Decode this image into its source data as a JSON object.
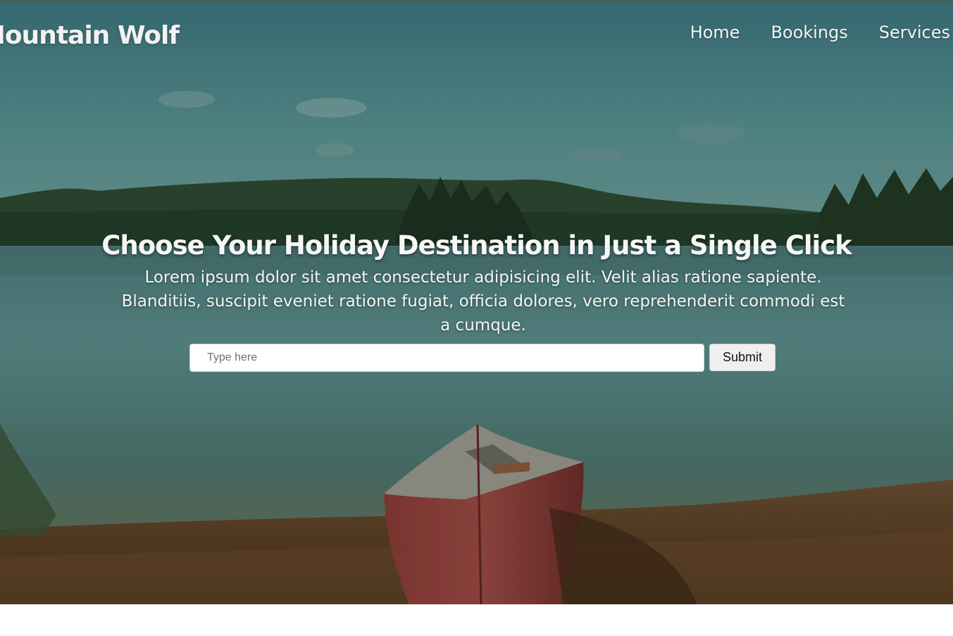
{
  "brand": {
    "name": "Mountain Wolf"
  },
  "nav": {
    "items": [
      {
        "label": "Home"
      },
      {
        "label": "Bookings"
      },
      {
        "label": "Services"
      }
    ]
  },
  "hero": {
    "headline": "Choose Your Holiday Destination in Just a Single Click",
    "subtext": "Lorem ipsum dolor sit amet consectetur adipisicing elit. Velit alias ratione sapiente. Blanditiis, suscipit eveniet ratione fugiat, officia dolores, vero reprehenderit commodi est a cumque."
  },
  "search": {
    "placeholder": "Type here",
    "value": "",
    "submit_label": "Submit"
  }
}
